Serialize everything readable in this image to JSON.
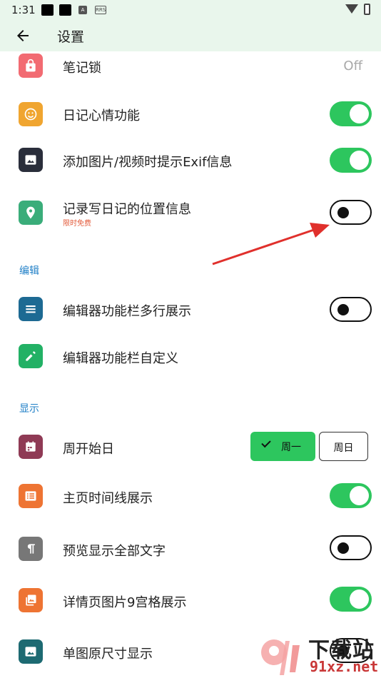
{
  "status": {
    "time": "1:31",
    "badge1": "A",
    "badge2": "RRS"
  },
  "appbar": {
    "title": "设置"
  },
  "colors": {
    "accent_green": "#2dc65e",
    "section_blue": "#1f7fc7",
    "free_tag": "#e35a3a"
  },
  "items": [
    {
      "label": "笔记锁",
      "value": "Off",
      "icon": "lock-icon",
      "icon_color": "#f26b72"
    },
    {
      "label": "日记心情功能",
      "toggle": "on",
      "icon": "smiley-icon",
      "icon_color": "#f0a530"
    },
    {
      "label": "添加图片/视频时提示Exif信息",
      "toggle": "on",
      "icon": "image-icon",
      "icon_color": "#2a2e3b"
    },
    {
      "label": "记录写日记的位置信息",
      "sublabel": "限时免费",
      "toggle": "off",
      "icon": "location-pin-icon",
      "icon_color": "#3aad7a"
    }
  ],
  "sections": {
    "edit": "编辑",
    "display": "显示"
  },
  "edit_items": [
    {
      "label": "编辑器功能栏多行展示",
      "toggle": "off",
      "icon": "menu-lines-icon",
      "icon_color": "#1d6a93"
    },
    {
      "label": "编辑器功能栏自定义",
      "icon": "pencil-icon",
      "icon_color": "#22b165"
    }
  ],
  "display_items": [
    {
      "label": "周开始日",
      "icon": "calendar-icon",
      "icon_color": "#8f3a55",
      "options": [
        "周一",
        "周日"
      ],
      "selected": "周一"
    },
    {
      "label": "主页时间线展示",
      "toggle": "on",
      "icon": "list-icon",
      "icon_color": "#ee7433"
    },
    {
      "label": "预览显示全部文字",
      "toggle": "off",
      "icon": "paragraph-icon",
      "icon_color": "#777777"
    },
    {
      "label": "详情页图片9宫格展示",
      "toggle": "on",
      "icon": "gallery-icon",
      "icon_color": "#ee7433"
    },
    {
      "label": "单图原尺寸显示",
      "toggle": "off",
      "icon": "image-icon",
      "icon_color": "#1d6a72"
    }
  ],
  "watermark": {
    "name": "下载站",
    "url": "91xz.net"
  }
}
